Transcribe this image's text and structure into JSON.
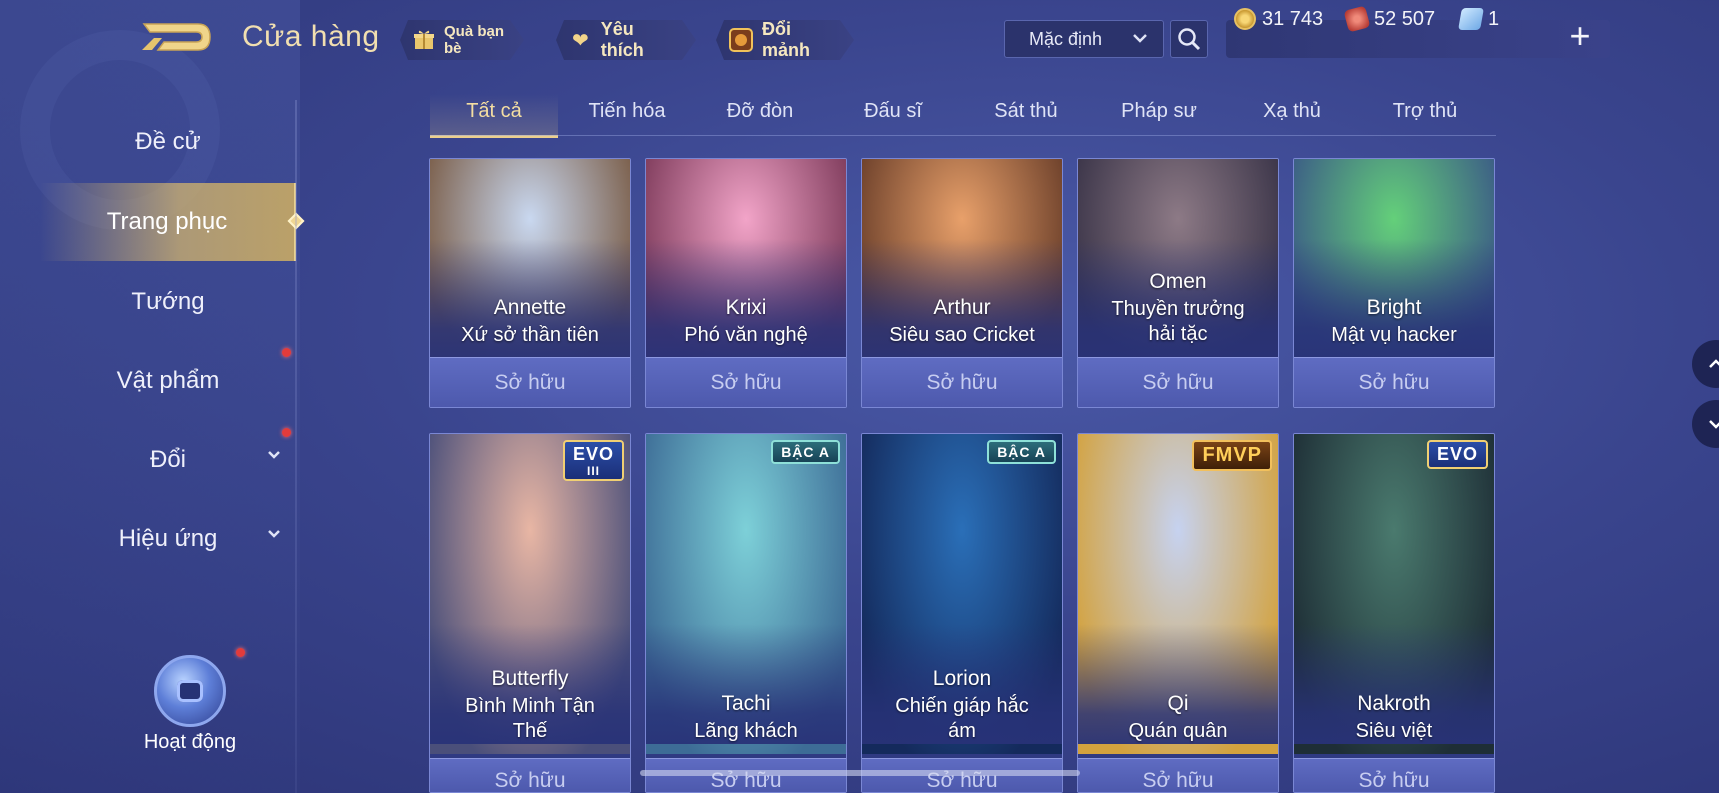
{
  "header": {
    "title": "Cửa hàng",
    "gift_label": "Quà bạn bè",
    "fav_label": "Yêu thích",
    "fragment_label": "Đổi mảnh",
    "sort_value": "Mặc định",
    "currency": {
      "gold": "31 743",
      "voucher": "52 507",
      "ticket": "1"
    }
  },
  "sidebar": {
    "items": [
      {
        "label": "Đề cử"
      },
      {
        "label": "Trang phục"
      },
      {
        "label": "Tướng"
      },
      {
        "label": "Vật phẩm"
      },
      {
        "label": "Đổi"
      },
      {
        "label": "Hiệu ứng"
      }
    ],
    "activity_label": "Hoạt động"
  },
  "tabs": [
    {
      "label": "Tất cả"
    },
    {
      "label": "Tiến hóa"
    },
    {
      "label": "Đỡ đòn"
    },
    {
      "label": "Đấu sĩ"
    },
    {
      "label": "Sát thủ"
    },
    {
      "label": "Pháp sư"
    },
    {
      "label": "Xạ thủ"
    },
    {
      "label": "Trợ thủ"
    }
  ],
  "cards": [
    {
      "hero": "Annette",
      "skin": "Xứ sở thần tiên",
      "status": "Sở hữu",
      "colors": [
        "#c9d8f0",
        "#7a5d48"
      ]
    },
    {
      "hero": "Krixi",
      "skin": "Phó văn nghệ",
      "status": "Sở hữu",
      "colors": [
        "#f2a4c8",
        "#7e3b5b"
      ]
    },
    {
      "hero": "Arthur",
      "skin": "Siêu sao Cricket",
      "status": "Sở hữu",
      "colors": [
        "#e8a06a",
        "#6b3f2a"
      ]
    },
    {
      "hero": "Omen",
      "skin": "Thuyền trưởng hải tặc",
      "status": "Sở hữu",
      "colors": [
        "#8d7a86",
        "#3a3448"
      ]
    },
    {
      "hero": "Bright",
      "skin": "Mật vụ hacker",
      "status": "Sở hữu",
      "colors": [
        "#64d07a",
        "#3b5b86"
      ]
    },
    {
      "hero": "Butterfly",
      "skin": "Bình Minh Tận Thế",
      "status": "Sở hữu",
      "badge": "EVO",
      "badge_sub": "III",
      "colors": [
        "#e8b6a4",
        "#4a4f7a"
      ]
    },
    {
      "hero": "Tachi",
      "skin": "Lãng khách",
      "status": "Sở hữu",
      "badge": "BẬC A",
      "colors": [
        "#7dd0d8",
        "#3d6c96"
      ]
    },
    {
      "hero": "Lorion",
      "skin": "Chiến giáp hắc ám",
      "status": "Sở hữu",
      "badge": "BẬC A",
      "colors": [
        "#2a6fb8",
        "#142a5c"
      ]
    },
    {
      "hero": "Qi",
      "skin": "Quán quân",
      "status": "Sở hữu",
      "badge": "FMVP",
      "colors": [
        "#c6d2f0",
        "#d3a23e"
      ]
    },
    {
      "hero": "Nakroth",
      "skin": "Siêu việt",
      "status": "Sở hữu",
      "badge": "EVO",
      "colors": [
        "#4a7a6e",
        "#1e2e36"
      ]
    }
  ]
}
